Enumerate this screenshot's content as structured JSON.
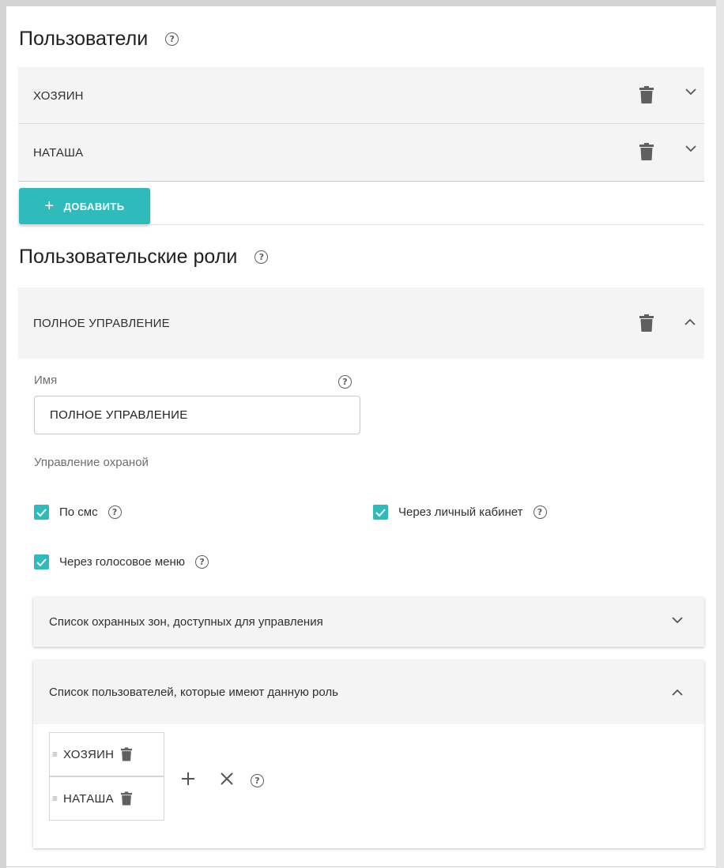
{
  "users_section": {
    "title": "Пользователи",
    "users": [
      {
        "label": "ХОЗЯИН"
      },
      {
        "label": "НАТАША"
      }
    ],
    "add_label": "ДОБАВИТЬ"
  },
  "roles_section": {
    "title": "Пользовательские роли",
    "role": {
      "header_label": "ПОЛНОЕ УПРАВЛЕНИЕ",
      "name_field_label": "Имя",
      "name_value": "ПОЛНОЕ УПРАВЛЕНИЕ",
      "security_group_label": "Управление охраной",
      "checkboxes": [
        {
          "label": "По смс",
          "checked": true
        },
        {
          "label": "Через личный кабинет",
          "checked": true
        },
        {
          "label": "Через голосовое меню",
          "checked": true
        }
      ],
      "zones_panel_label": "Список охранных зон, доступных для управления",
      "users_panel_label": "Список пользователей, которые имеют данную роль",
      "assigned_users": [
        "ХОЗЯИН",
        "НАТАША"
      ]
    }
  },
  "icons": {
    "help": "help-circle-icon",
    "delete": "trash-icon",
    "expand": "chevron-down-icon",
    "collapse": "chevron-up-icon",
    "add": "plus-icon",
    "clear": "close-icon",
    "drag": "drag-handle-icon"
  },
  "colors": {
    "accent": "#2fbbbb",
    "header_bg": "#f4f4f4",
    "icon": "#5f5f5f"
  }
}
